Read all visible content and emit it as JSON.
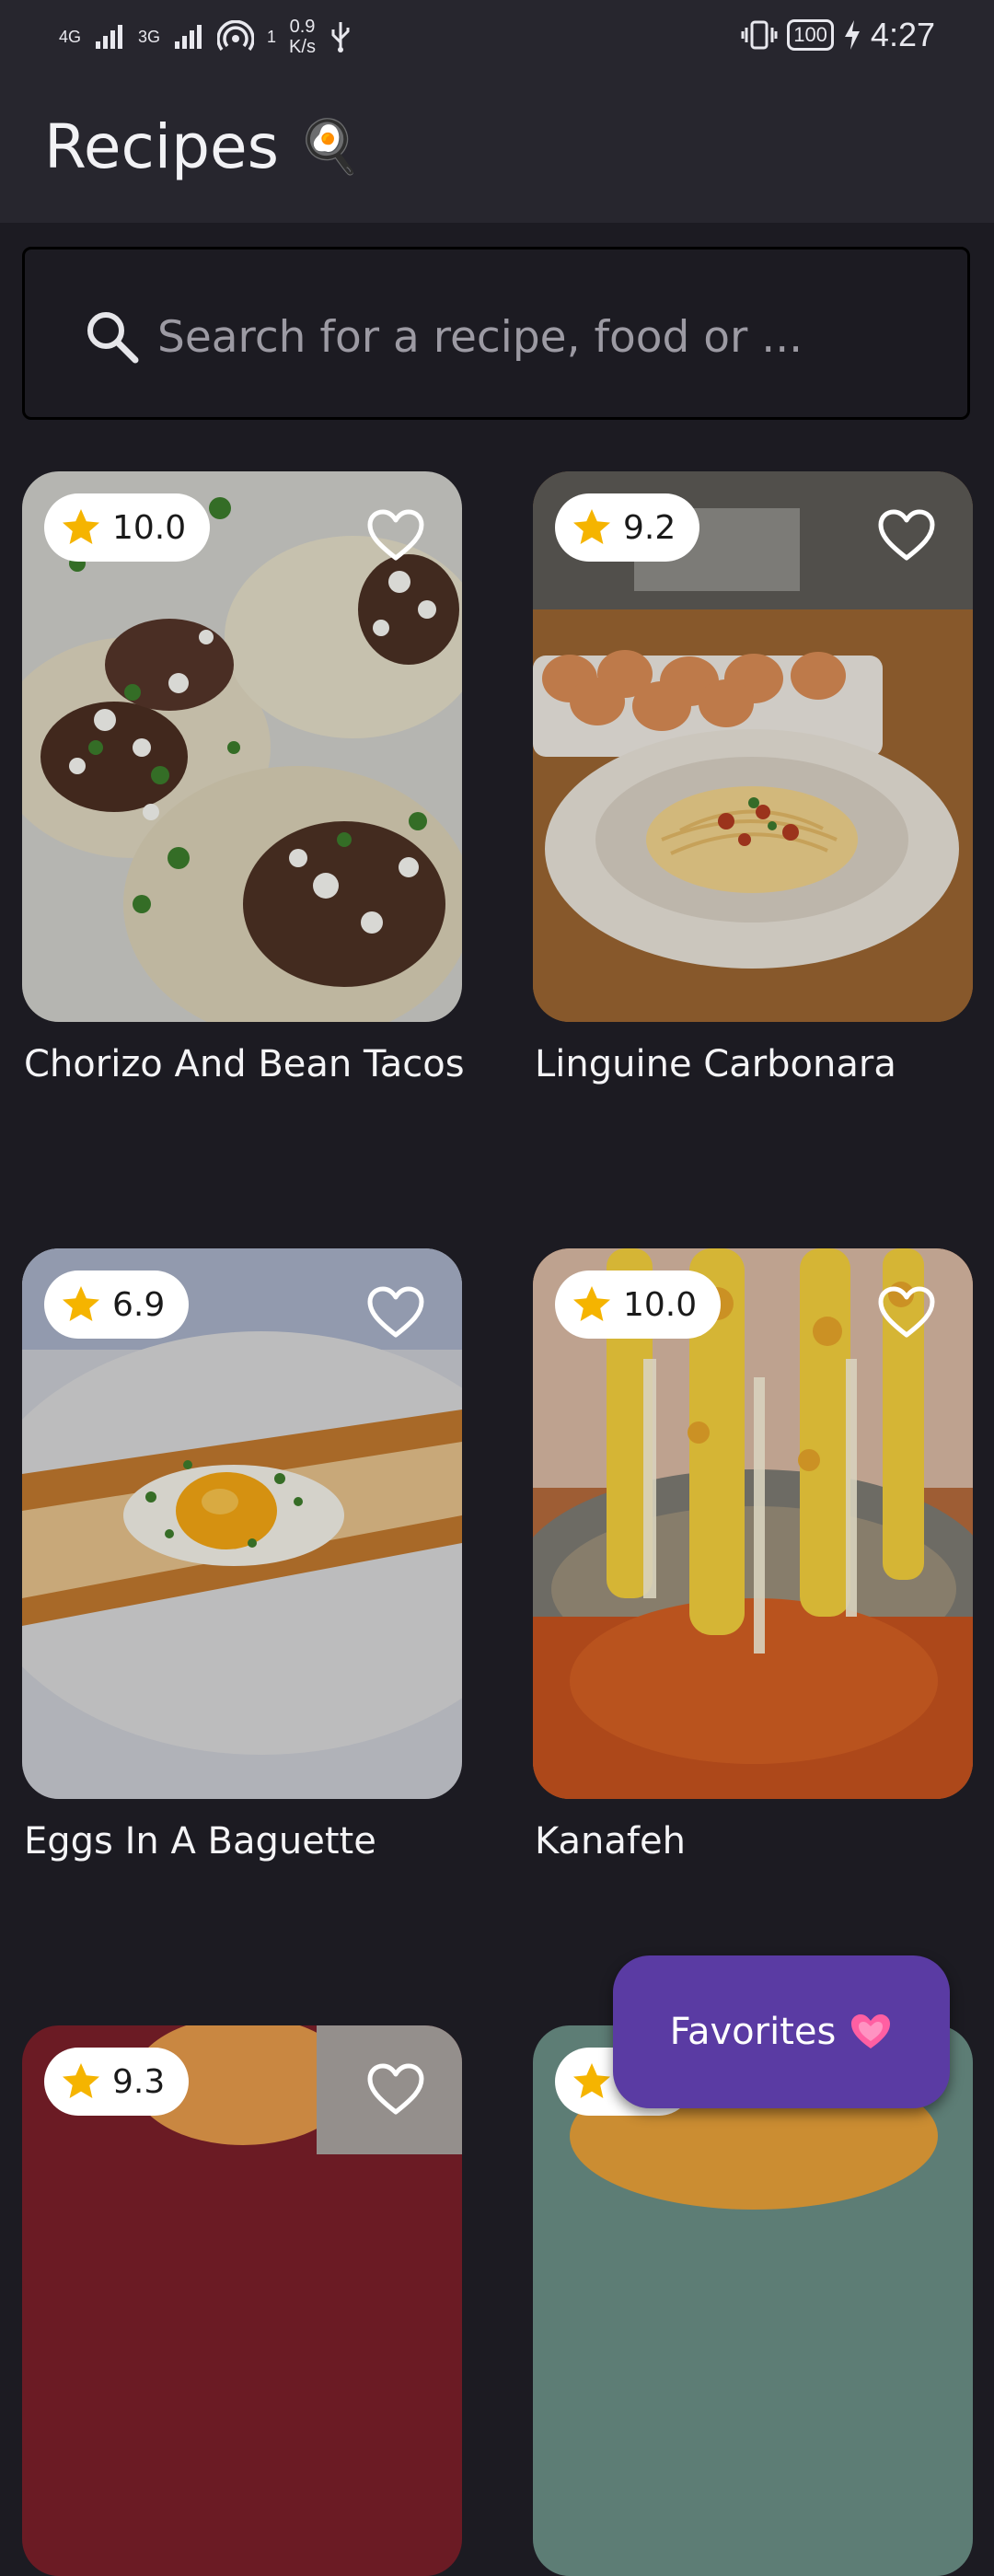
{
  "status_bar": {
    "network_1": "4G",
    "network_2": "3G",
    "hotspot_count": "1",
    "net_speed_value": "0.9",
    "net_speed_unit": "K/s",
    "battery": "100",
    "time": "4:27"
  },
  "app_bar": {
    "title": "Recipes",
    "title_emoji": "🍳"
  },
  "search": {
    "placeholder": "Search for a recipe, food or ...",
    "icon": "search-icon"
  },
  "recipes": [
    {
      "title": "Chorizo And Bean Tacos",
      "rating": "10.0",
      "favorite": false
    },
    {
      "title": "Linguine Carbonara",
      "rating": "9.2",
      "favorite": false
    },
    {
      "title": "Eggs In A Baguette",
      "rating": "6.9",
      "favorite": false
    },
    {
      "title": "Kanafeh",
      "rating": "10.0",
      "favorite": false
    },
    {
      "title": "",
      "rating": "9.3",
      "favorite": false
    },
    {
      "title": "",
      "rating": "",
      "favorite": false
    }
  ],
  "fab": {
    "label": "Favorites",
    "emoji": "💓"
  },
  "colors": {
    "background": "#1c1b22",
    "app_bar": "#27262e",
    "fab": "#5a3ba3",
    "star": "#f5b400"
  }
}
